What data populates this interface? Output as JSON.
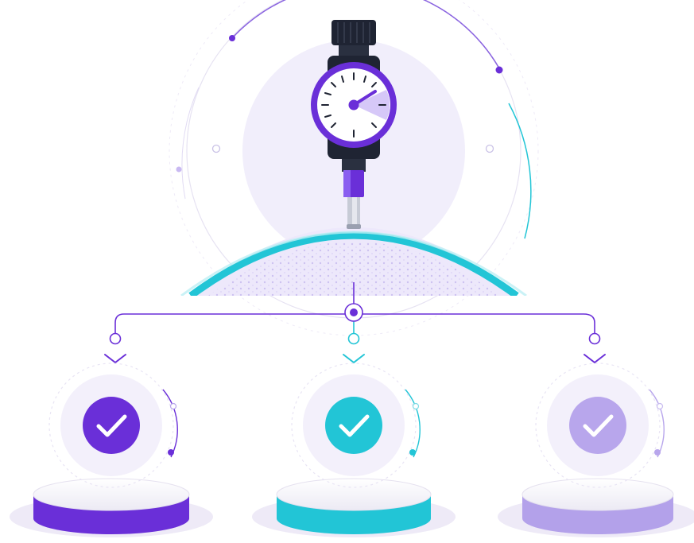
{
  "illustration": {
    "gauge": {
      "icon": "dial-indicator-gauge-icon",
      "needle_level": 0.18
    },
    "outcomes": [
      {
        "icon": "check-circle-icon",
        "color": "#6a2fd8",
        "base_color": "#6a2fd8"
      },
      {
        "icon": "check-circle-icon",
        "color": "#22c5d6",
        "base_color": "#22c5d6"
      },
      {
        "icon": "check-circle-icon",
        "color": "#b8a6ec",
        "base_color": "#b3a1ea"
      }
    ],
    "colors": {
      "primary_purple": "#6a2fd8",
      "teal": "#22c5d6",
      "lavender": "#b8a6ec",
      "dark": "#1f2433",
      "soft_bg": "#f1eefb"
    }
  }
}
